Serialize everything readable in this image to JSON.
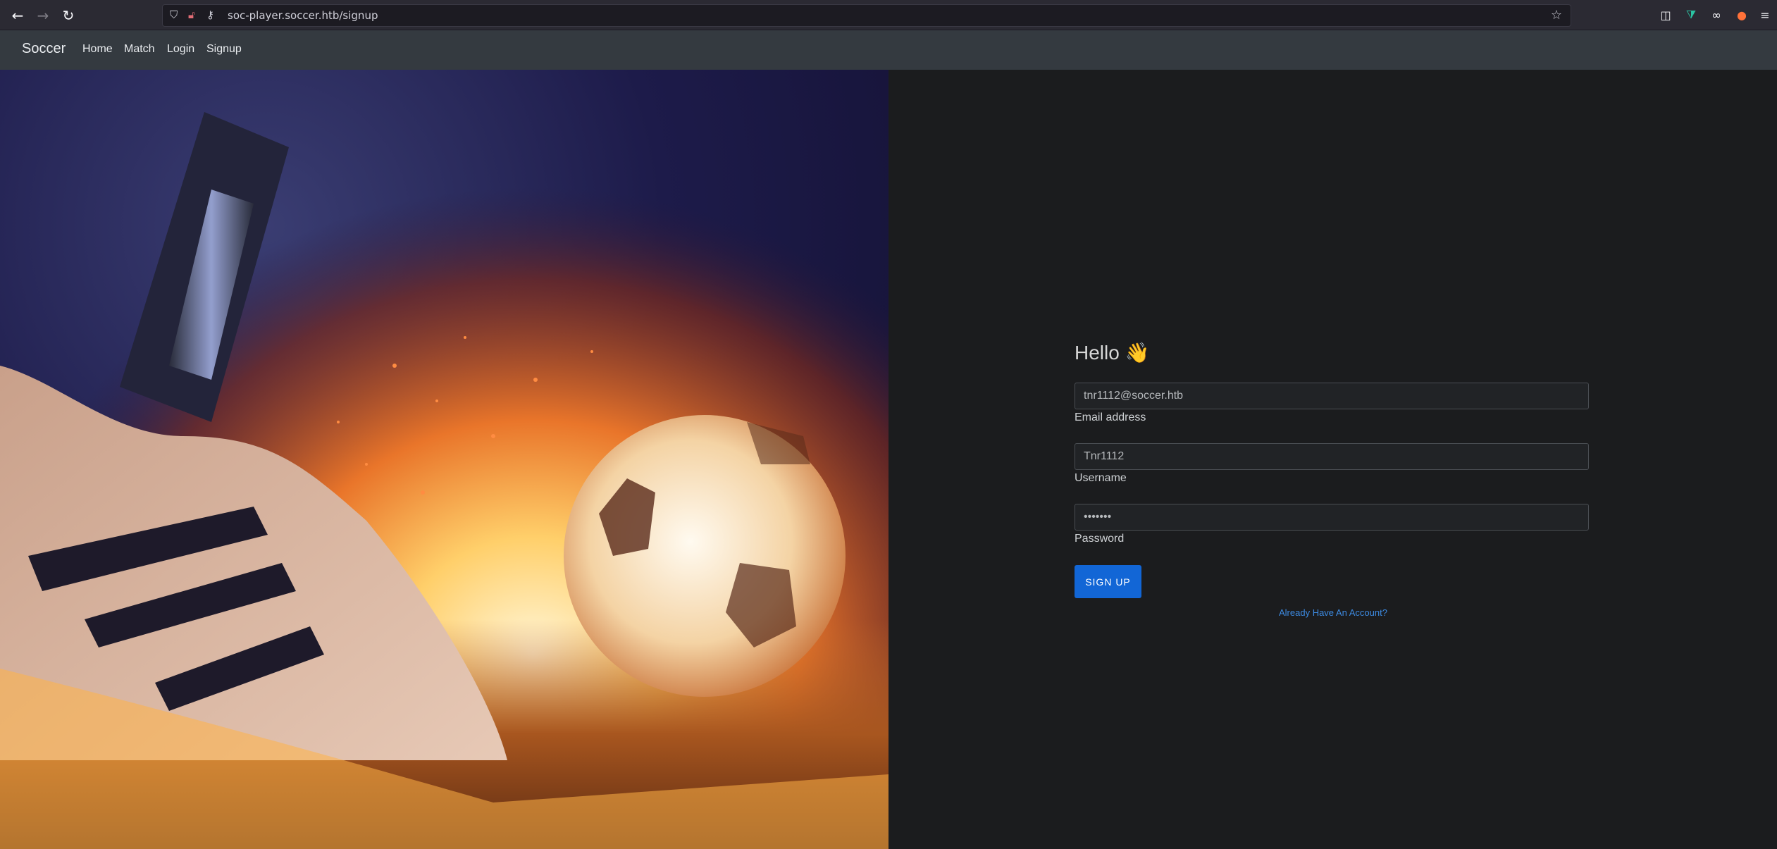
{
  "browser": {
    "url": "soc-player.soccer.htb/signup",
    "icons": [
      "back-icon",
      "forward-icon",
      "reload-icon",
      "shield-icon",
      "lock-icon",
      "key-icon",
      "bookmark-star-icon",
      "pocket-icon",
      "extension-icon",
      "mask-icon",
      "firefox-icon",
      "menu-icon"
    ]
  },
  "site": {
    "brand": "Soccer",
    "nav": [
      "Home",
      "Match",
      "Login",
      "Signup"
    ]
  },
  "form": {
    "heading": "Hello 👋",
    "email_value": "tnr1112@soccer.htb",
    "email_label": "Email address",
    "username_value": "Tnr1112",
    "username_label": "Username",
    "password_value": "•••••••",
    "password_label": "Password",
    "submit_label": "SIGN UP",
    "account_link": "Already Have An Account?"
  },
  "colors": {
    "accent": "#1266d6",
    "link": "#3d8be3",
    "navbar": "#343a40",
    "panel": "#1b1c1e"
  }
}
